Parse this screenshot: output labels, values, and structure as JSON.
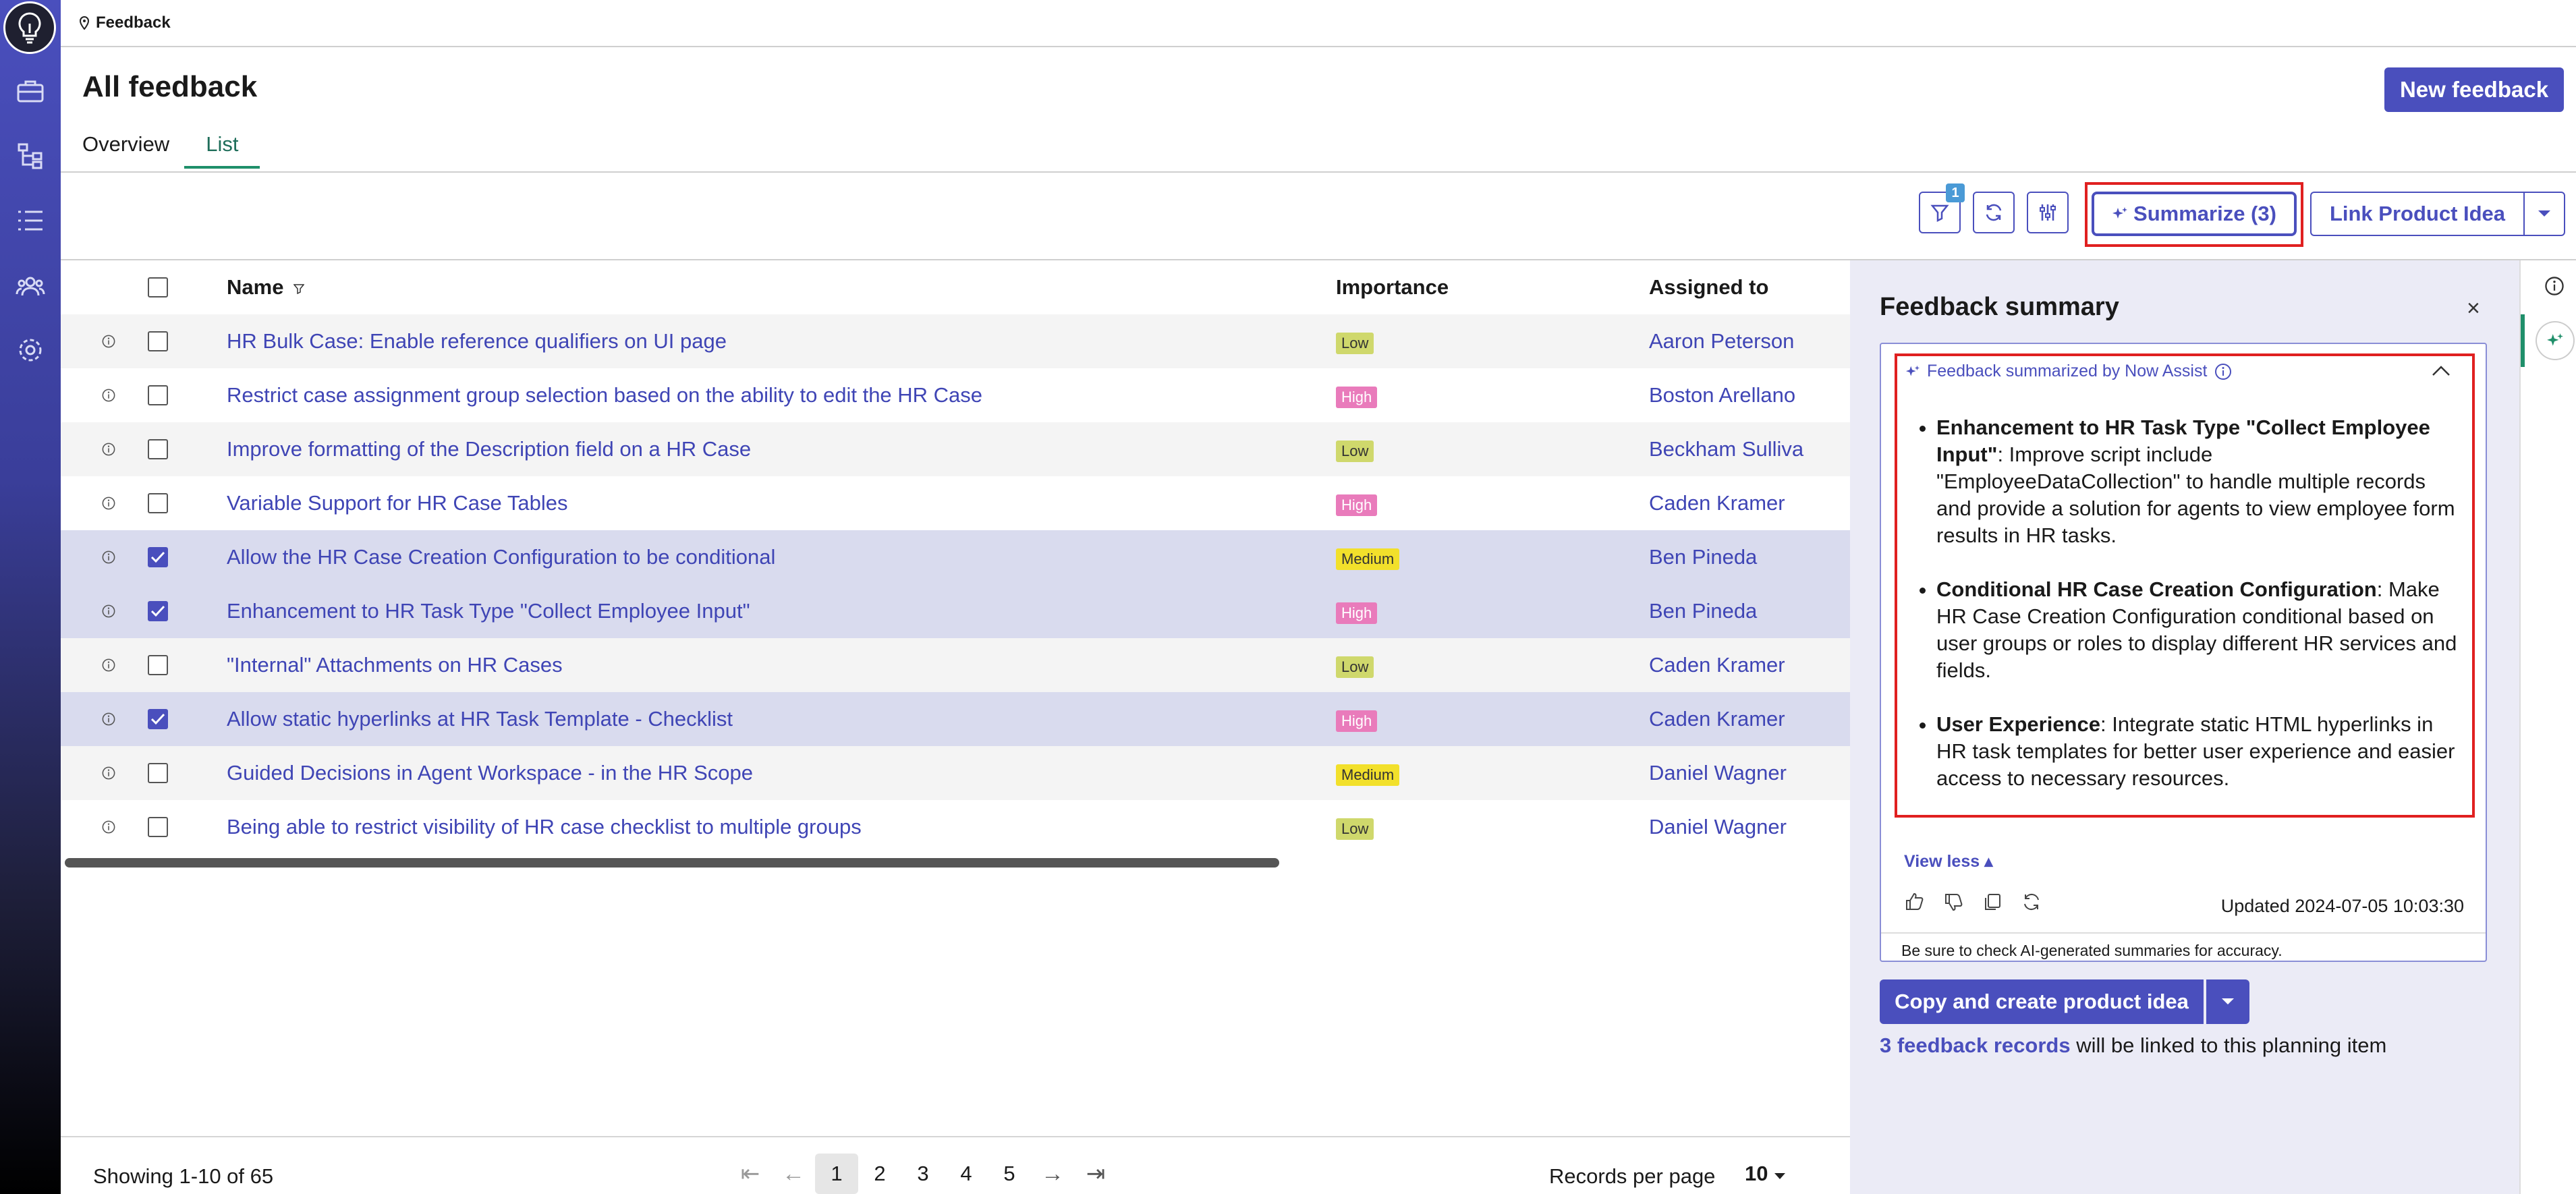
{
  "breadcrumb": {
    "label": "Feedback"
  },
  "page": {
    "title": "All feedback",
    "new_button": "New feedback"
  },
  "tabs": [
    {
      "label": "Overview",
      "active": false
    },
    {
      "label": "List",
      "active": true
    }
  ],
  "toolbar": {
    "filter_count": "1",
    "summarize_label": "Summarize (3)",
    "link_label": "Link Product Idea"
  },
  "table": {
    "columns": {
      "name": "Name",
      "importance": "Importance",
      "assigned": "Assigned to"
    },
    "rows": [
      {
        "name": "HR Bulk Case: Enable reference qualifiers on UI page",
        "importance": "Low",
        "assigned": "Aaron Peterson",
        "checked": false
      },
      {
        "name": "Restrict case assignment group selection based on the ability to edit the HR Case",
        "importance": "High",
        "assigned": "Boston Arellano",
        "checked": false
      },
      {
        "name": "Improve formatting of the Description field on a HR Case",
        "importance": "Low",
        "assigned": "Beckham Sulliva",
        "checked": false
      },
      {
        "name": "Variable Support for HR Case Tables",
        "importance": "High",
        "assigned": "Caden Kramer",
        "checked": false
      },
      {
        "name": "Allow the HR Case Creation Configuration to be conditional",
        "importance": "Medium",
        "assigned": "Ben Pineda",
        "checked": true
      },
      {
        "name": "Enhancement to HR Task Type \"Collect Employee Input\"",
        "importance": "High",
        "assigned": "Ben Pineda",
        "checked": true
      },
      {
        "name": "\"Internal\" Attachments on HR Cases",
        "importance": "Low",
        "assigned": "Caden Kramer",
        "checked": false
      },
      {
        "name": "Allow static hyperlinks at HR Task Template - Checklist",
        "importance": "High",
        "assigned": "Caden Kramer",
        "checked": true
      },
      {
        "name": "Guided Decisions in Agent Workspace - in the HR Scope",
        "importance": "Medium",
        "assigned": "Daniel Wagner",
        "checked": false
      },
      {
        "name": "Being able to restrict visibility of HR case checklist to multiple groups",
        "importance": "Low",
        "assigned": "Daniel Wagner",
        "checked": false
      }
    ]
  },
  "footer": {
    "showing": "Showing 1-10 of 65",
    "pages": [
      "1",
      "2",
      "3",
      "4",
      "5"
    ],
    "current_page": "1",
    "records_label": "Records per page",
    "records_value": "10"
  },
  "summary": {
    "title": "Feedback summary",
    "assist_label": "Feedback summarized by Now Assist",
    "items": [
      {
        "title": "Enhancement to HR Task Type \"Collect Employee Input\"",
        "text": ": Improve script include \"EmployeeDataCollection\" to handle multiple records and provide a solution for agents to view employee form results in HR tasks."
      },
      {
        "title": "Conditional HR Case Creation Configuration",
        "text": ": Make HR Case Creation Configuration conditional based on user groups or roles to display different HR services and fields."
      },
      {
        "title": "User Experience",
        "text": ": Integrate static HTML hyperlinks in HR task templates for better user experience and easier access to necessary resources."
      }
    ],
    "view_less": "View less",
    "updated": "Updated 2024-07-05 10:03:30",
    "disclaimer": "Be sure to check AI-generated summaries for accuracy.",
    "copy_button": "Copy and create product idea",
    "linked_count": "3 feedback records",
    "linked_text": " will be linked to this planning item"
  },
  "colors": {
    "accent": "#4a4fbd",
    "selected_row": "#d9dbee",
    "low": "#cfd86c",
    "high": "#e97bbb",
    "medium": "#f2e02b"
  }
}
